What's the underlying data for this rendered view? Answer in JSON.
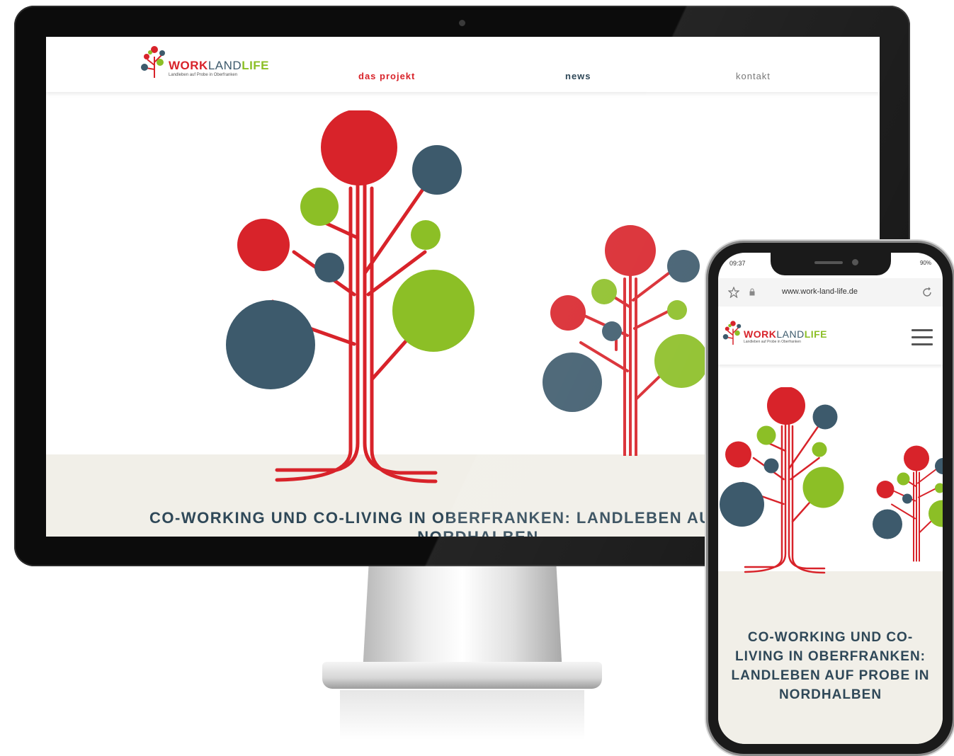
{
  "site": {
    "logo": {
      "part1": "WORK",
      "part2": "LAND",
      "part3": "LIFE",
      "tagline": "Landleben auf Probe in Oberfranken"
    },
    "nav": [
      {
        "label": "DAS PROJEKT",
        "active": true
      },
      {
        "label": "NEWS",
        "active": false
      },
      {
        "label": "KONTAKT",
        "active": false
      }
    ],
    "hero_title": "CO-WORKING UND CO-LIVING IN OBERFRANKEN: LANDLEBEN AUF PR",
    "hero_title_line2": "NORDHALBEN",
    "hero_title_full": "CO-WORKING UND CO-LIVING IN OBERFRANKEN: LANDLEBEN AUF PROBE IN NORDHALBEN"
  },
  "phone": {
    "status_time": "09:37",
    "status_right": "90%",
    "url": "www.work-land-life.de",
    "icons": [
      "star-icon",
      "lock-icon",
      "refresh-icon",
      "hamburger-menu-icon"
    ]
  },
  "colors": {
    "red": "#d8232a",
    "green": "#8cbf26",
    "blue": "#3d5a6c",
    "beige": "#f1efe8",
    "title": "#2f4858"
  }
}
